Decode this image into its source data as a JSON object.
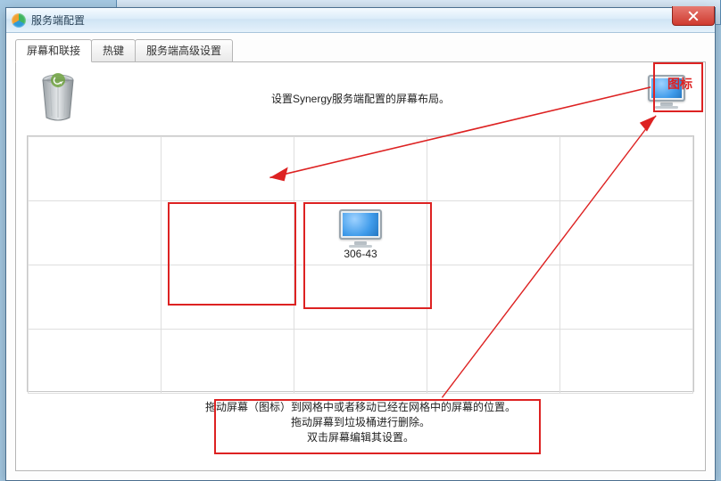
{
  "window": {
    "title": "服务端配置"
  },
  "tabs": {
    "screens": "屏幕和联接",
    "hotkeys": "热键",
    "advanced": "服务端高级设置"
  },
  "panel": {
    "instruction": "设置Synergy服务端配置的屏幕布局。",
    "grid": {
      "center_screen_label": "306-43"
    },
    "help": {
      "line1": "拖动屏幕（图标）到网格中或者移动已经在网格中的屏幕的位置。",
      "line2": "拖动屏幕到垃圾桶进行删除。",
      "line3": "双击屏幕编辑其设置。"
    }
  },
  "annotations": {
    "source_label": "图标"
  }
}
